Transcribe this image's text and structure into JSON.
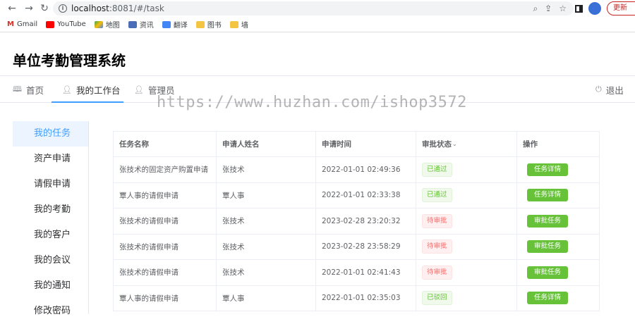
{
  "browser": {
    "url_host": "localhost",
    "url_path": ":8081/#/task",
    "update_label": "更新",
    "bookmarks": [
      {
        "label": "Gmail",
        "icon": "gmail-icon"
      },
      {
        "label": "YouTube",
        "icon": "youtube-icon"
      },
      {
        "label": "地图",
        "icon": "maps-icon"
      },
      {
        "label": "资讯",
        "icon": "news-icon"
      },
      {
        "label": "翻译",
        "icon": "translate-icon"
      },
      {
        "label": "图书",
        "icon": "folder-icon"
      },
      {
        "label": "墙",
        "icon": "folder-icon"
      }
    ]
  },
  "app": {
    "title": "单位考勤管理系统",
    "watermark": "https://www.huzhan.com/ishop3572"
  },
  "topnav": {
    "home": "首页",
    "workbench": "我的工作台",
    "admin": "管理员",
    "logout": "退出"
  },
  "sidebar": {
    "items": [
      {
        "label": "我的任务",
        "active": true
      },
      {
        "label": "资产申请",
        "active": false
      },
      {
        "label": "请假申请",
        "active": false
      },
      {
        "label": "我的考勤",
        "active": false
      },
      {
        "label": "我的客户",
        "active": false
      },
      {
        "label": "我的会议",
        "active": false
      },
      {
        "label": "我的通知",
        "active": false
      },
      {
        "label": "修改密码",
        "active": false
      }
    ]
  },
  "table": {
    "columns": [
      "任务名称",
      "申请人姓名",
      "申请时间",
      "审批状态",
      "操作"
    ],
    "rows": [
      {
        "task": "张技术的固定资产购置申请",
        "applicant": "张技术",
        "time": "2022-01-01 02:49:36",
        "status": "已通过",
        "status_type": "pass",
        "action": "任务详情"
      },
      {
        "task": "覃人事的请假申请",
        "applicant": "覃人事",
        "time": "2022-01-01 02:33:38",
        "status": "已通过",
        "status_type": "pass",
        "action": "任务详情"
      },
      {
        "task": "张技术的请假申请",
        "applicant": "张技术",
        "time": "2023-02-28 23:20:32",
        "status": "待审批",
        "status_type": "pending",
        "action": "审批任务"
      },
      {
        "task": "张技术的请假申请",
        "applicant": "张技术",
        "time": "2023-02-28 23:58:29",
        "status": "待审批",
        "status_type": "pending",
        "action": "审批任务"
      },
      {
        "task": "张技术的请假申请",
        "applicant": "张技术",
        "time": "2022-01-01 02:41:43",
        "status": "待审批",
        "status_type": "pending",
        "action": "审批任务"
      },
      {
        "task": "覃人事的请假申请",
        "applicant": "覃人事",
        "time": "2022-01-01 02:35:03",
        "status": "已驳回",
        "status_type": "pass",
        "action": "任务详情"
      }
    ]
  }
}
